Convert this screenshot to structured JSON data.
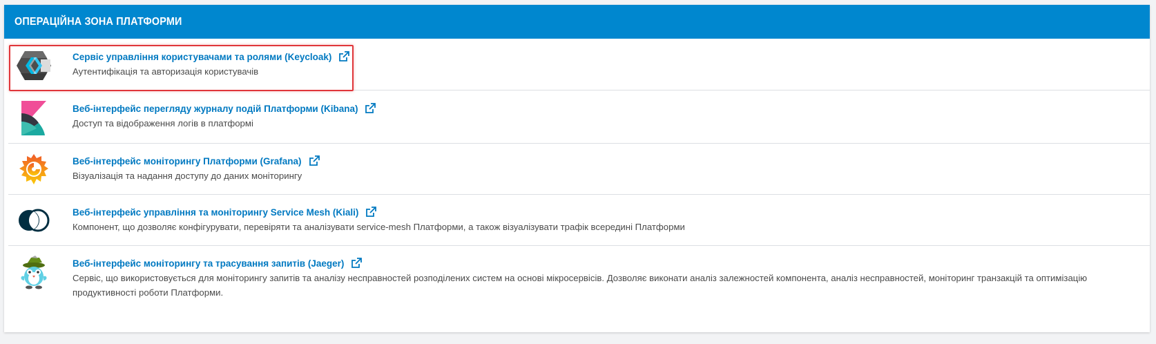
{
  "panel": {
    "title": "Операційна зона Платформи",
    "accent_color": "#0087cf",
    "link_color": "#0079c1",
    "highlight_color": "#e0363a"
  },
  "items": [
    {
      "title": "Сервіс управління користувачами та ролями (Keycloak)",
      "description": "Аутентифікація та авторизація користувачів",
      "icon": "keycloak-logo-icon",
      "highlighted": true
    },
    {
      "title": "Веб-інтерфейс перегляду журналу подій Платформи (Kibana)",
      "description": "Доступ та відображення логів в платформі",
      "icon": "kibana-logo-icon"
    },
    {
      "title": "Веб-інтерфейс моніторингу Платформи (Grafana)",
      "description": "Візуалізація та надання доступу до даних моніторингу",
      "icon": "grafana-logo-icon"
    },
    {
      "title": "Веб-інтерфейс управління та моніторингу Service Mesh (Kiali)",
      "description": "Компонент, що дозволяє конфігурувати, перевіряти та аналізувати service-mesh Платформи, а також візуалізувати трафік всередині Платформи",
      "icon": "kiali-logo-icon"
    },
    {
      "title": "Веб-інтерфейс моніторингу та трасування запитів (Jaeger)",
      "description": "Сервіс, що використовується для моніторингу запитів та аналізу несправностей розподілених систем на основі мікросервісів. Дозволяє виконати аналіз залежностей компонента, аналіз несправностей, моніторинг транзакцій та оптимізацію продуктивності роботи Платформи.",
      "icon": "jaeger-logo-icon"
    }
  ],
  "external_link_icon": "external-link-icon"
}
